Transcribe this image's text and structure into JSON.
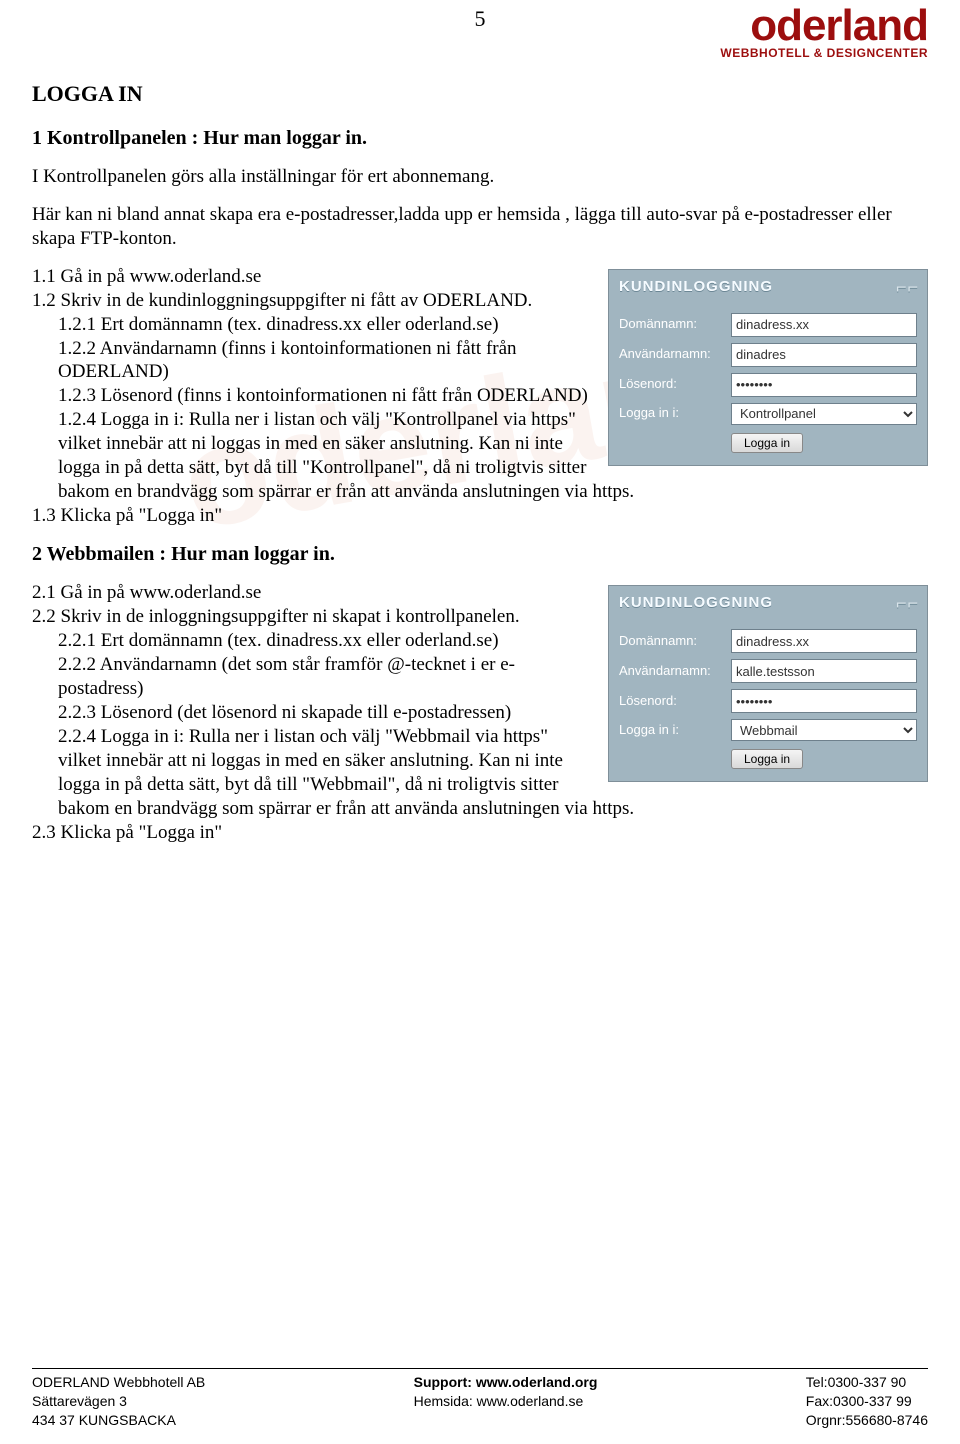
{
  "page_number": "5",
  "logo": {
    "main": "oderland",
    "sub": "WEBBHOTELL & DESIGNCENTER"
  },
  "watermark": "oderland",
  "title": "LOGGA IN",
  "sect1": {
    "heading": "1  Kontrollpanelen : Hur man loggar in."
  },
  "intro_p1": "I Kontrollpanelen görs alla inställningar för ert abonnemang.",
  "intro_p2": "Här kan ni bland annat skapa era e-postadresser,ladda upp er hemsida , lägga till auto-svar på e-postadresser eller skapa FTP-konton.",
  "l11": "1.1  Gå in på www.oderland.se",
  "l12": "1.2  Skriv in de kundinloggningsuppgifter ni fått av ODERLAND.",
  "l121": "1.2.1  Ert domännamn (tex. dinadress.xx eller oderland.se)",
  "l122": "1.2.2  Användarnamn (finns i kontoinformationen ni fått från ODERLAND)",
  "l123": "1.2.3  Lösenord (finns i kontoinformationen ni fått från ODERLAND)",
  "l124": "1.2.4  Logga in i: Rulla ner i listan och välj \"Kontrollpanel via https\" vilket innebär att ni loggas in med en säker anslutning. Kan ni inte logga in på detta sätt, byt då till \"Kontrollpanel\", då ni troligtvis sitter bakom en brandvägg som spärrar er från att använda anslutningen via https.",
  "l13": "1.3  Klicka på \"Logga in\"",
  "sect2": {
    "heading": "2  Webbmailen : Hur man loggar in."
  },
  "l21": "2.1  Gå in på www.oderland.se",
  "l22": "2.2  Skriv in de inloggningsuppgifter ni skapat i kontrollpanelen.",
  "l221": "2.2.1  Ert domännamn (tex. dinadress.xx eller oderland.se)",
  "l222": "2.2.2  Användarnamn (det som står framför @-tecknet i er e-postadress)",
  "l223": "2.2.3  Lösenord (det lösenord ni skapade till e-postadressen)",
  "l224": "2.2.4  Logga in i: Rulla ner i listan och välj \"Webbmail via https\" vilket innebär att ni loggas in med en säker anslutning. Kan ni inte logga in på detta sätt, byt då till \"Webbmail\", då ni troligtvis sitter bakom en brandvägg som spärrar er från att använda anslutningen via https.",
  "l23": "2.3  Klicka på \"Logga in\"",
  "login_panel": {
    "title": "KUNDINLOGGNING",
    "labels": {
      "domain": "Domännamn:",
      "user": "Användarnamn:",
      "pass": "Lösenord:",
      "loginin": "Logga in i:"
    },
    "button": "Logga in"
  },
  "panel1": {
    "domain": "dinadress.xx",
    "user": "dinadres",
    "pass": "********",
    "option": "Kontrollpanel"
  },
  "panel2": {
    "domain": "dinadress.xx",
    "user": "kalle.testsson",
    "pass": "********",
    "option": "Webbmail"
  },
  "footer": {
    "c1l1": "ODERLAND Webbhotell AB",
    "c1l2": "Sättarevägen 3",
    "c1l3": "434 37 KUNGSBACKA",
    "c2l1_label": "Support:",
    "c2l1": " www.oderland.org",
    "c2l2": "Hemsida: www.oderland.se",
    "c3l1": "Tel:0300-337 90",
    "c3l2": "Fax:0300-337 99",
    "c3l3": "Orgnr:556680-8746"
  }
}
